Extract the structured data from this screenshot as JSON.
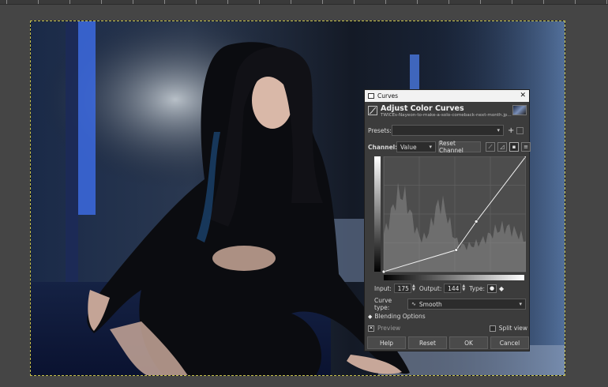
{
  "canvas": {
    "alt": "photo"
  },
  "dialog": {
    "window_title": "Curves",
    "header_title": "Adjust Color Curves",
    "header_subtitle": "TWICEs-Nayeon-to-make-a-solo-comeback-next-month.jp...",
    "presets_label": "Presets:",
    "presets_value": "",
    "channel_label": "Channel:",
    "channel_value": "Value",
    "reset_channel": "Reset Channel",
    "input_label": "Input:",
    "input_value": "175",
    "output_label": "Output:",
    "output_value": "144",
    "type_label": "Type:",
    "curve_type_label": "Curve type:",
    "curve_type_value": "Smooth",
    "blending_label": "Blending Options",
    "preview_label": "Preview",
    "preview_checked": true,
    "split_view_label": "Split view",
    "split_view_checked": false,
    "buttons": {
      "help": "Help",
      "reset": "Reset",
      "ok": "OK",
      "cancel": "Cancel"
    },
    "close_glyph": "✕",
    "icons": [
      "curves-icon",
      "add-preset-icon",
      "manage-presets-icon",
      "linear-histogram-icon",
      "log-histogram-icon",
      "smooth-type-icon",
      "corner-type-icon"
    ]
  },
  "curve": {
    "points": [
      [
        0,
        0
      ],
      [
        130,
        48
      ],
      [
        166,
        111
      ],
      [
        255,
        255
      ]
    ]
  }
}
